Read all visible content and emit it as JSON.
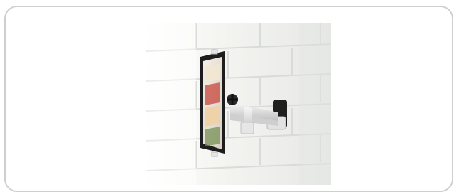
{
  "product_image": {
    "icon": "tablet-wall-mount-image"
  },
  "colors": {
    "frame_border": "#cfcfcf",
    "tile_light": "#f3f3f1",
    "tile_grout": "#d6d8d6",
    "metal": "#e7e7e7",
    "tablet_dark": "#1d1d1f"
  }
}
